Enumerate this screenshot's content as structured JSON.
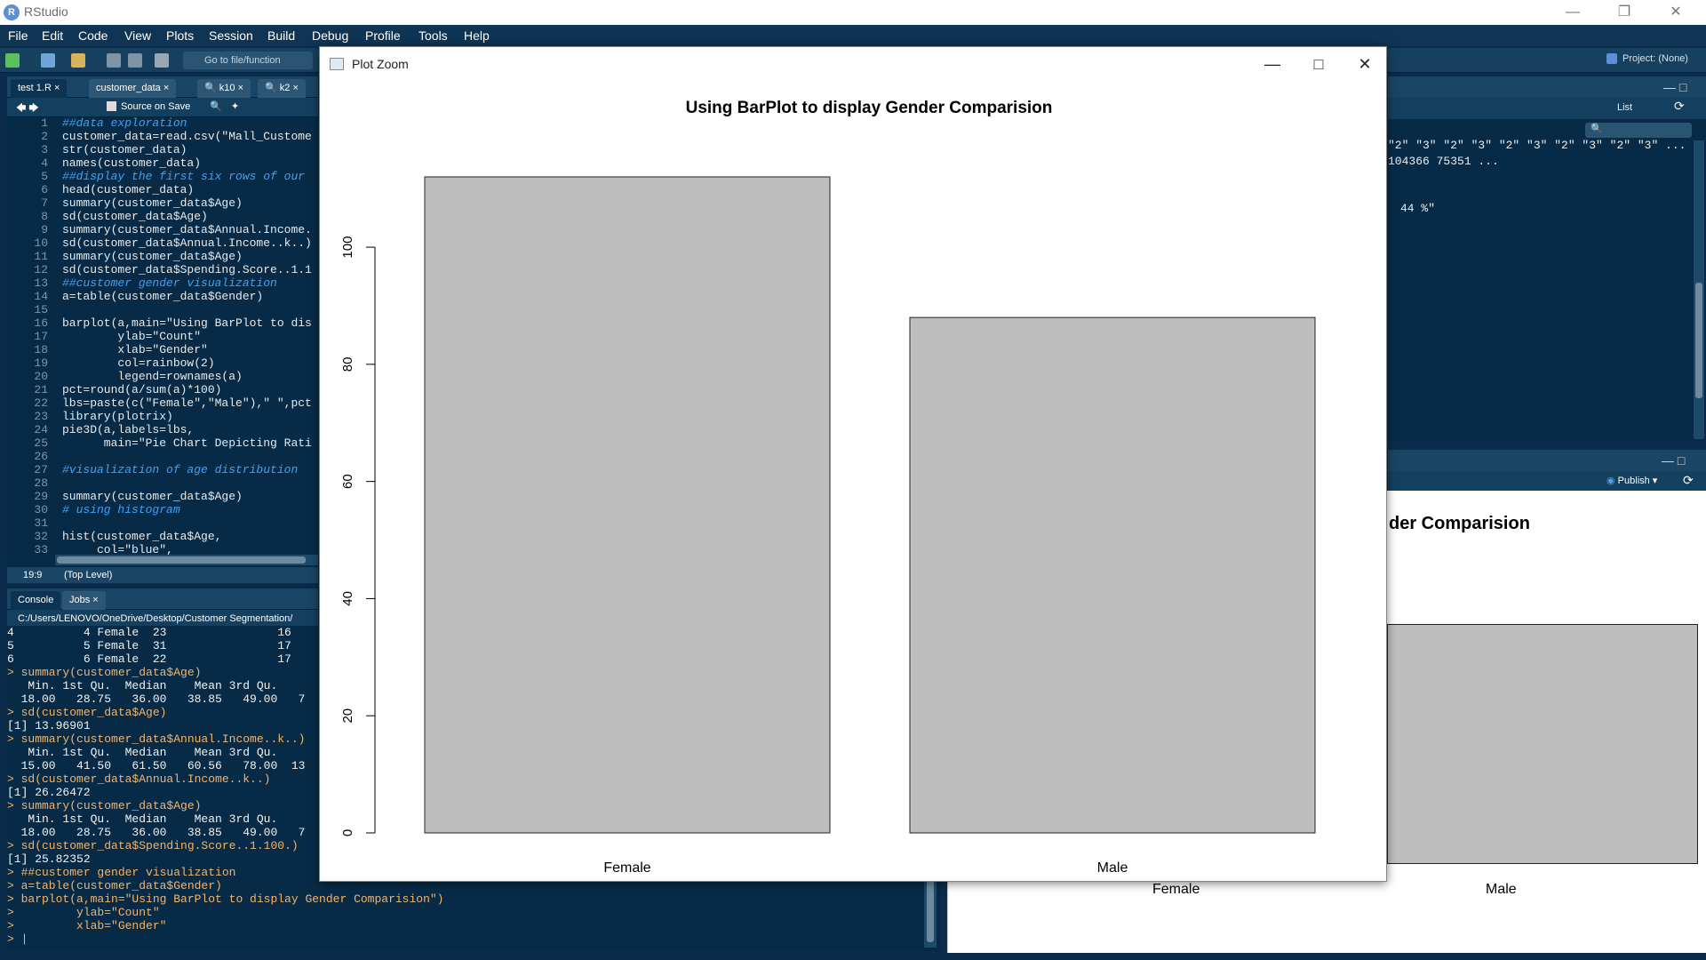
{
  "app": {
    "title": "RStudio",
    "project": "Project: (None)"
  },
  "menu": [
    "File",
    "Edit",
    "Code",
    "View",
    "Plots",
    "Session",
    "Build",
    "Debug",
    "Profile",
    "Tools",
    "Help"
  ],
  "toolbar": {
    "goto_label": "Go to file/function"
  },
  "editor": {
    "tabs": [
      "test 1.R",
      "customer_data",
      "k10",
      "k2"
    ],
    "source_on_save": "Source on Save",
    "status_position": "19:9",
    "status_scope": "(Top Level)",
    "lines": [
      {
        "n": "1",
        "t": "##data exploration",
        "c": "c-com"
      },
      {
        "n": "2",
        "t": "customer_data=read.csv(\"Mall_Custome",
        "c": "c-txt"
      },
      {
        "n": "3",
        "t": "str(customer_data)",
        "c": "c-txt"
      },
      {
        "n": "4",
        "t": "names(customer_data)",
        "c": "c-txt"
      },
      {
        "n": "5",
        "t": "##display the first six rows of our",
        "c": "c-com"
      },
      {
        "n": "6",
        "t": "head(customer_data)",
        "c": "c-txt"
      },
      {
        "n": "7",
        "t": "summary(customer_data$Age)",
        "c": "c-txt"
      },
      {
        "n": "8",
        "t": "sd(customer_data$Age)",
        "c": "c-txt"
      },
      {
        "n": "9",
        "t": "summary(customer_data$Annual.Income.",
        "c": "c-txt"
      },
      {
        "n": "10",
        "t": "sd(customer_data$Annual.Income..k..)",
        "c": "c-txt"
      },
      {
        "n": "11",
        "t": "summary(customer_data$Age)",
        "c": "c-txt"
      },
      {
        "n": "12",
        "t": "sd(customer_data$Spending.Score..1.1",
        "c": "c-txt"
      },
      {
        "n": "13",
        "t": "##customer gender visualization",
        "c": "c-com"
      },
      {
        "n": "14",
        "t": "a=table(customer_data$Gender)",
        "c": "c-txt"
      },
      {
        "n": "15",
        "t": "",
        "c": "c-txt"
      },
      {
        "n": "16",
        "t": "barplot(a,main=\"Using BarPlot to dis",
        "c": "c-txt"
      },
      {
        "n": "17",
        "t": "        ylab=\"Count\"",
        "c": "c-txt"
      },
      {
        "n": "18",
        "t": "        xlab=\"Gender\"",
        "c": "c-txt"
      },
      {
        "n": "19",
        "t": "        col=rainbow(2)",
        "c": "c-txt"
      },
      {
        "n": "20",
        "t": "        legend=rownames(a)",
        "c": "c-txt"
      },
      {
        "n": "21",
        "t": "pct=round(a/sum(a)*100)",
        "c": "c-txt"
      },
      {
        "n": "22",
        "t": "lbs=paste(c(\"Female\",\"Male\"),\" \",pct",
        "c": "c-txt"
      },
      {
        "n": "23",
        "t": "library(plotrix)",
        "c": "c-txt"
      },
      {
        "n": "24",
        "t": "pie3D(a,labels=lbs,",
        "c": "c-txt"
      },
      {
        "n": "25",
        "t": "      main=\"Pie Chart Depicting Rati",
        "c": "c-txt"
      },
      {
        "n": "26",
        "t": "",
        "c": "c-txt"
      },
      {
        "n": "27",
        "t": "#visualization of age distribution",
        "c": "c-com"
      },
      {
        "n": "28",
        "t": "",
        "c": "c-txt"
      },
      {
        "n": "29",
        "t": "summary(customer_data$Age)",
        "c": "c-txt"
      },
      {
        "n": "30",
        "t": "# using histogram",
        "c": "c-com"
      },
      {
        "n": "31",
        "t": "",
        "c": "c-txt"
      },
      {
        "n": "32",
        "t": "hist(customer_data$Age,",
        "c": "c-txt"
      },
      {
        "n": "33",
        "t": "     col=\"blue\",",
        "c": "c-txt"
      },
      {
        "n": "34",
        "t": "",
        "c": "c-txt"
      }
    ]
  },
  "console": {
    "tabs": [
      "Console",
      "Jobs"
    ],
    "path": "C:/Users/LENOVO/OneDrive/Desktop/Customer Segmentation/",
    "lines": [
      {
        "t": "4          4 Female  23                16",
        "k": "out"
      },
      {
        "t": "5          5 Female  31                17",
        "k": "out"
      },
      {
        "t": "6          6 Female  22                17",
        "k": "out"
      },
      {
        "t": "> summary(customer_data$Age)",
        "k": "cmd"
      },
      {
        "t": "   Min. 1st Qu.  Median    Mean 3rd Qu.",
        "k": "out"
      },
      {
        "t": "  18.00   28.75   36.00   38.85   49.00   7",
        "k": "out"
      },
      {
        "t": "> sd(customer_data$Age)",
        "k": "cmd"
      },
      {
        "t": "[1] 13.96901",
        "k": "out"
      },
      {
        "t": "> summary(customer_data$Annual.Income..k..)",
        "k": "cmd"
      },
      {
        "t": "   Min. 1st Qu.  Median    Mean 3rd Qu.",
        "k": "out"
      },
      {
        "t": "  15.00   41.50   61.50   60.56   78.00  13",
        "k": "out"
      },
      {
        "t": "> sd(customer_data$Annual.Income..k..)",
        "k": "cmd"
      },
      {
        "t": "[1] 26.26472",
        "k": "out"
      },
      {
        "t": "> summary(customer_data$Age)",
        "k": "cmd"
      },
      {
        "t": "   Min. 1st Qu.  Median    Mean 3rd Qu.",
        "k": "out"
      },
      {
        "t": "  18.00   28.75   36.00   38.85   49.00   7",
        "k": "out"
      },
      {
        "t": "> sd(customer_data$Spending.Score..1.100.)",
        "k": "cmd"
      },
      {
        "t": "[1] 25.82352",
        "k": "out"
      },
      {
        "t": "> ##customer gender visualization",
        "k": "cmd"
      },
      {
        "t": "> a=table(customer_data$Gender)",
        "k": "cmd"
      },
      {
        "t": "> barplot(a,main=\"Using BarPlot to display Gender Comparision\")",
        "k": "cmd"
      },
      {
        "t": ">         ylab=\"Count\"",
        "k": "cmd"
      },
      {
        "t": ">         xlab=\"Gender\"",
        "k": "cmd"
      },
      {
        "t": "> |",
        "k": "cmd"
      }
    ]
  },
  "env_pane": {
    "view_label": "List",
    "line1": "\"2\" \"3\" \"2\" \"3\" \"2\" \"3\" \"2\" \"3\" \"2\" \"3\" ...",
    "line2": "104366 75351 ...",
    "line3": "44 %\""
  },
  "plots_pane": {
    "publish_label": "Publish",
    "title_fragment": "der Comparision",
    "category_female": "Female",
    "category_male": "Male"
  },
  "plot_zoom": {
    "title": "Plot Zoom",
    "chart_data": {
      "type": "bar",
      "title": "Using BarPlot to display Gender Comparision",
      "categories": [
        "Female",
        "Male"
      ],
      "values": [
        112,
        88
      ],
      "yticks": [
        0,
        20,
        40,
        60,
        80,
        100
      ],
      "ylim": [
        0,
        112
      ],
      "bar_color": "#bebebe",
      "grid": false
    }
  }
}
